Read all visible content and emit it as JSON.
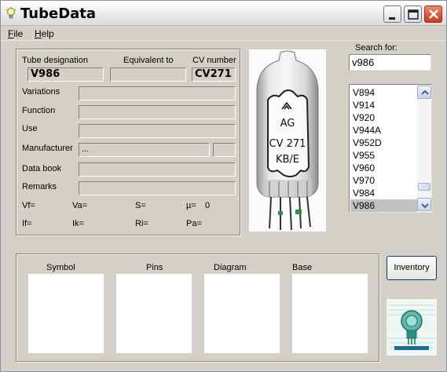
{
  "window": {
    "title": "TubeData",
    "controls": [
      "minimize",
      "maximize",
      "close"
    ]
  },
  "menu": {
    "file": "File",
    "help": "Help"
  },
  "info": {
    "tube_designation_label": "Tube designation",
    "equivalent_to_label": "Equivalent to",
    "cv_number_label": "CV number",
    "tube_designation": "V986",
    "equivalent_to": "",
    "cv_number": "CV271",
    "variations_label": "Variations",
    "function_label": "Function",
    "use_label": "Use",
    "manufacturer_label": "Manufacturer",
    "manufacturer_value": "...",
    "data_book_label": "Data book",
    "remarks_label": "Remarks",
    "params": {
      "vf": "Vf=",
      "va": "Va=",
      "s": "S=",
      "mu": "µ=",
      "mu_value": "0",
      "if": "If=",
      "ik": "Ik=",
      "ri": "Ri=",
      "pa": "Pa="
    }
  },
  "photo": {
    "markings": [
      "AG",
      "CV 271",
      "KB/E"
    ]
  },
  "search": {
    "label": "Search for:",
    "value": "v986",
    "results": [
      "V894",
      "V914",
      "V920",
      "V944A",
      "V952D",
      "V955",
      "V960",
      "V970",
      "V984",
      "V986"
    ],
    "selected": "V986"
  },
  "panels": {
    "symbol": "Symbol",
    "pins": "Pins",
    "diagram": "Diagram",
    "base": "Base"
  },
  "inventory_button": "Inventory",
  "colors": {
    "window_bg": "#d4d0c8",
    "close_button": "#c8391d",
    "selection": "#c2c2c2"
  }
}
